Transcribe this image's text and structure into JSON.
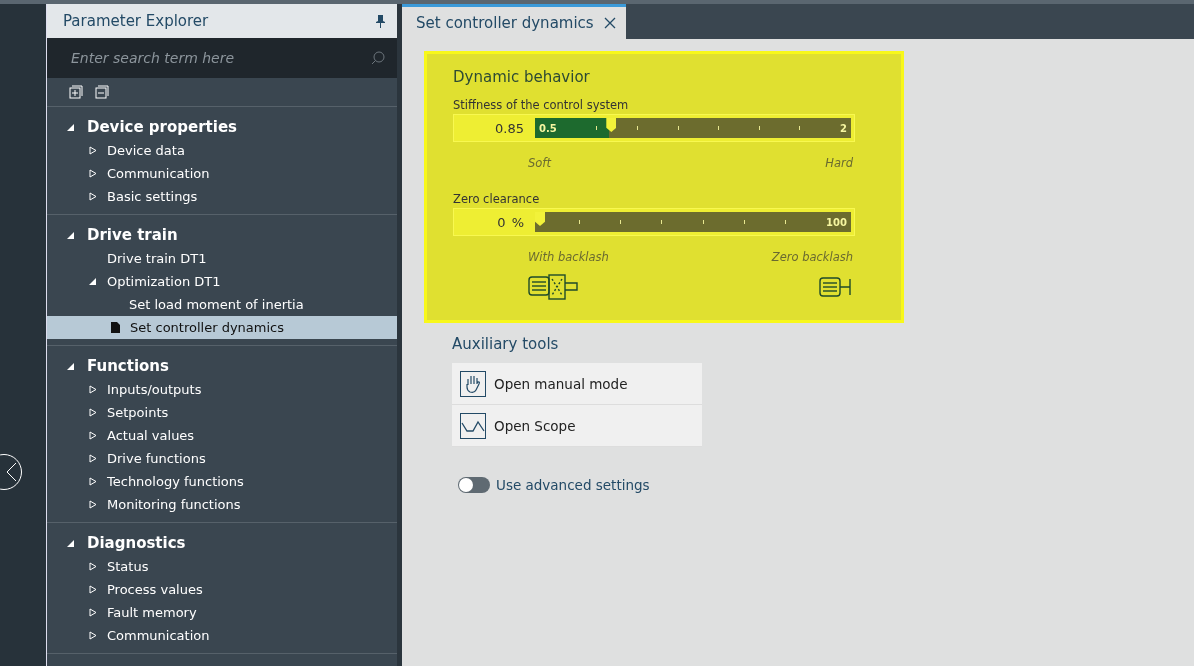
{
  "explorer": {
    "title": "Parameter Explorer",
    "search": {
      "placeholder": "Enter search term here"
    },
    "sections": [
      {
        "label": "Device properties",
        "expanded": true,
        "children": [
          {
            "label": "Device data",
            "kind": "group",
            "expanded": false,
            "selected": false
          },
          {
            "label": "Communication",
            "kind": "group",
            "expanded": false,
            "selected": false
          },
          {
            "label": "Basic settings",
            "kind": "group",
            "expanded": false,
            "selected": false
          }
        ]
      },
      {
        "label": "Drive train",
        "expanded": true,
        "children": [
          {
            "label": "Drive train DT1",
            "kind": "plain",
            "selected": false
          },
          {
            "label": "Optimization DT1",
            "kind": "group",
            "expanded": true,
            "selected": false,
            "children": [
              {
                "label": "Set load moment of inertia",
                "kind": "plain",
                "selected": false
              },
              {
                "label": "Set controller dynamics",
                "kind": "page",
                "selected": true
              }
            ]
          }
        ]
      },
      {
        "label": "Functions",
        "expanded": true,
        "children": [
          {
            "label": "Inputs/outputs",
            "kind": "group",
            "expanded": false,
            "selected": false
          },
          {
            "label": "Setpoints",
            "kind": "group",
            "expanded": false,
            "selected": false
          },
          {
            "label": "Actual values",
            "kind": "group",
            "expanded": false,
            "selected": false
          },
          {
            "label": "Drive functions",
            "kind": "group",
            "expanded": false,
            "selected": false
          },
          {
            "label": "Technology functions",
            "kind": "group",
            "expanded": false,
            "selected": false
          },
          {
            "label": "Monitoring functions",
            "kind": "group",
            "expanded": false,
            "selected": false
          }
        ]
      },
      {
        "label": "Diagnostics",
        "expanded": true,
        "children": [
          {
            "label": "Status",
            "kind": "group",
            "expanded": false,
            "selected": false
          },
          {
            "label": "Process values",
            "kind": "group",
            "expanded": false,
            "selected": false
          },
          {
            "label": "Fault memory",
            "kind": "group",
            "expanded": false,
            "selected": false
          },
          {
            "label": "Communication",
            "kind": "group",
            "expanded": false,
            "selected": false
          }
        ]
      }
    ]
  },
  "tabs": [
    {
      "label": "Set controller dynamics",
      "selected": true
    }
  ],
  "dynamic": {
    "title": "Dynamic behavior",
    "sliders": [
      {
        "label": "Stiffness of the control system",
        "value": "0.85",
        "min": "0.5",
        "max": "2",
        "level": 0.233,
        "left": "Soft",
        "right": "Hard"
      },
      {
        "label": "Zero clearance",
        "value": "0",
        "unit": "%",
        "max": "100",
        "level": 0,
        "left": "With backlash",
        "right": "Zero backlash"
      }
    ]
  },
  "auxiliary": {
    "title": "Auxiliary tools",
    "tools": [
      {
        "label": "Open manual mode",
        "kind": "hand"
      },
      {
        "label": "Open Scope",
        "kind": "scope"
      }
    ]
  },
  "advanced": {
    "label": "Use advanced settings",
    "on": false
  }
}
